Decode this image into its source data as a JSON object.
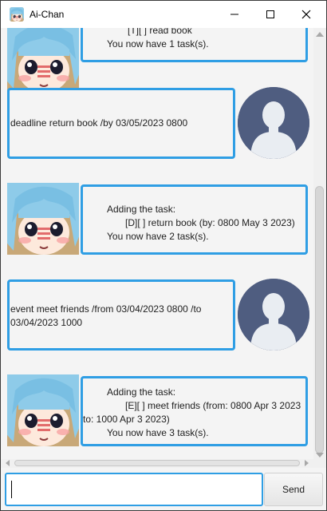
{
  "window": {
    "title": "Ai-Chan"
  },
  "colors": {
    "bubble_border": "#2f9ee4",
    "user_avatar_bg": "#4f5d80",
    "window_bg": "#f4f4f4"
  },
  "dialog": {
    "messages": [
      {
        "sender": "bot",
        "lines": [
          "[T][ ] read book",
          "You now have 1 task(s)."
        ]
      },
      {
        "sender": "user",
        "lines": [
          "deadline return book /by 03/05/2023 0800"
        ]
      },
      {
        "sender": "bot",
        "lines": [
          "Adding the task:",
          "[D][ ] return book (by: 0800 May 3 2023)",
          "You now have 2 task(s)."
        ]
      },
      {
        "sender": "user",
        "lines": [
          "event meet friends /from 03/04/2023 0800 /to 03/04/2023 1000"
        ]
      },
      {
        "sender": "bot",
        "lines": [
          "Adding the task:",
          "[E][ ] meet friends (from: 0800 Apr 3 2023",
          "to: 1000 Apr 3 2023)",
          "You now have 3 task(s)."
        ]
      }
    ]
  },
  "input": {
    "value": ""
  },
  "send_button": {
    "label": "Send"
  },
  "icons": {
    "bot_avatar": "anime-girl-avatar-icon",
    "user_avatar": "user-silhouette-icon"
  }
}
